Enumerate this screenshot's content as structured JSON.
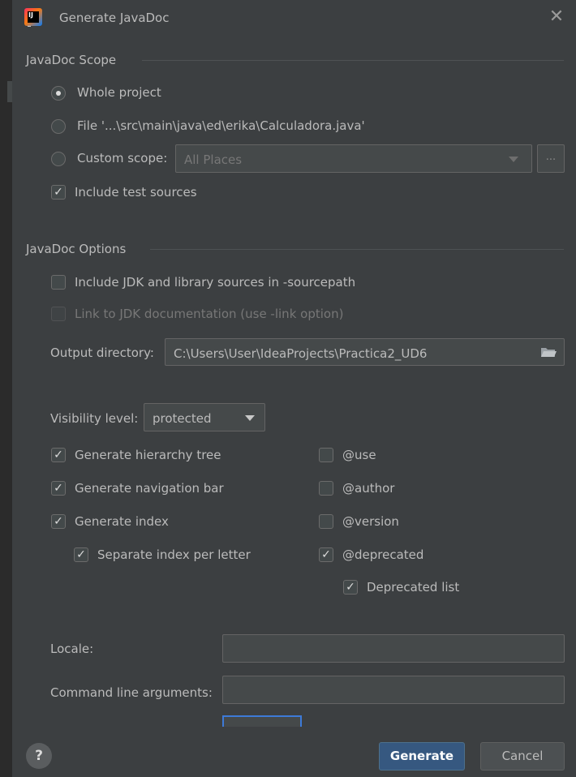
{
  "window": {
    "title": "Generate JavaDoc"
  },
  "scope": {
    "heading": "JavaDoc Scope",
    "whole_project": "Whole project",
    "file": "File '...\\src\\main\\java\\ed\\erika\\Calculadora.java'",
    "custom_scope": "Custom scope:",
    "custom_scope_value": "All Places",
    "browse": "...",
    "include_test_sources": "Include test sources"
  },
  "options": {
    "heading": "JavaDoc Options",
    "include_jdk": "Include JDK and library sources in -sourcepath",
    "link_jdk": "Link to JDK documentation (use -link option)",
    "output_directory_label": "Output directory:",
    "output_directory_value": "C:\\Users\\User\\IdeaProjects\\Practica2_UD6",
    "visibility_label": "Visibility level:",
    "visibility_value": "protected",
    "hierarchy_tree": "Generate hierarchy tree",
    "navigation_bar": "Generate navigation bar",
    "index": "Generate index",
    "separate_index": "Separate index per letter",
    "use_tag": "@use",
    "author_tag": "@author",
    "version_tag": "@version",
    "deprecated_tag": "@deprecated",
    "deprecated_list": "Deprecated list",
    "locale_label": "Locale:",
    "locale_value": "",
    "cmd_args_label": "Command line arguments:",
    "cmd_args_value": ""
  },
  "footer": {
    "help": "?",
    "generate": "Generate",
    "cancel": "Cancel"
  }
}
